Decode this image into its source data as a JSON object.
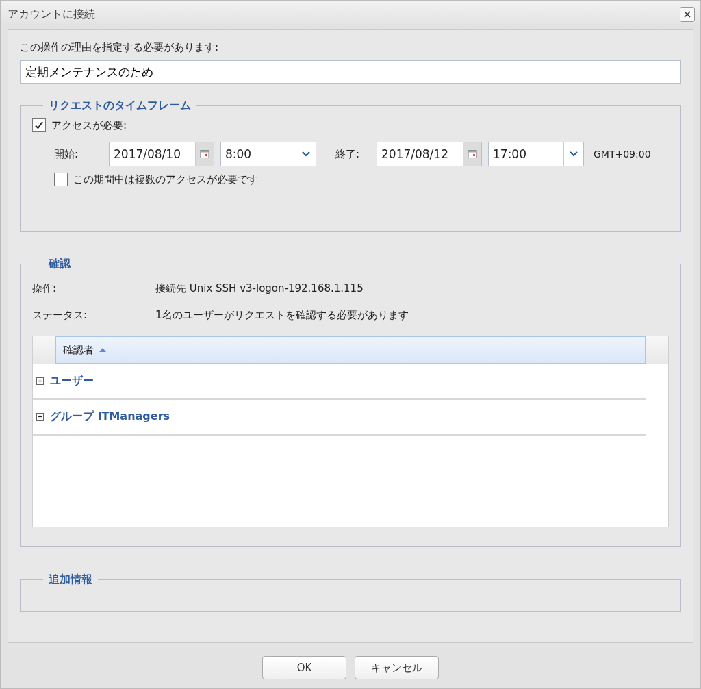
{
  "window": {
    "title": "アカウントに接続"
  },
  "reason": {
    "label": "この操作の理由を指定する必要があります:",
    "value": "定期メンテナンスのため"
  },
  "timeframe": {
    "legend": "リクエストのタイムフレーム",
    "access_required": {
      "label": "アクセスが必要:",
      "checked": true
    },
    "start": {
      "label": "開始:",
      "date": "2017/08/10",
      "time": "8:00"
    },
    "end": {
      "label": "終了:",
      "date": "2017/08/12",
      "time": "17:00"
    },
    "timezone": "GMT+09:00",
    "multiple_access": {
      "label": "この期間中は複数のアクセスが必要です",
      "checked": false
    }
  },
  "confirmation": {
    "legend": "確認",
    "fields": [
      {
        "label": "操作:",
        "value": "接続先 Unix SSH v3-logon-192.168.1.115"
      },
      {
        "label": "ステータス:",
        "value": "1名のユーザーがリクエストを確認する必要があります"
      }
    ],
    "table": {
      "column": "確認者",
      "groups": [
        {
          "label": "ユーザー",
          "expanded": false
        },
        {
          "label": "グループ ITManagers",
          "expanded": false
        }
      ]
    }
  },
  "additional_info": {
    "legend": "追加情報"
  },
  "buttons": [
    {
      "label": "OK"
    },
    {
      "label": "キャンセル"
    }
  ]
}
